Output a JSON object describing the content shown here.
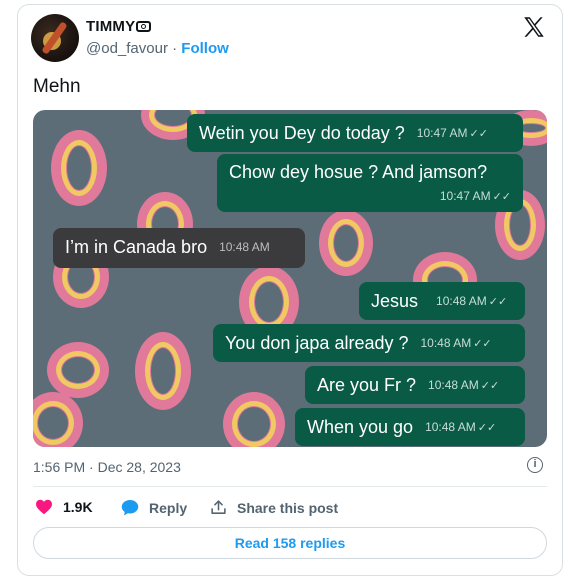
{
  "author": {
    "display_name": "TIMMY",
    "handle": "@od_favour",
    "separator": "·",
    "follow_label": "Follow"
  },
  "tweet": {
    "text": "Mehn",
    "timestamp": "1:56 PM · Dec 28, 2023"
  },
  "chat": {
    "messages": [
      {
        "text": "Wetin you Dey do today ?",
        "time": "10:47 AM",
        "direction": "outgoing"
      },
      {
        "text": "Chow dey hosue ? And jamson?",
        "time": "10:47 AM",
        "direction": "outgoing"
      },
      {
        "text": "I’m in Canada bro",
        "time": "10:48 AM",
        "direction": "incoming"
      },
      {
        "text": "Jesus",
        "time": "10:48 AM",
        "direction": "outgoing"
      },
      {
        "text": "You don japa already ?",
        "time": "10:48 AM",
        "direction": "outgoing"
      },
      {
        "text": "Are you Fr ?",
        "time": "10:48 AM",
        "direction": "outgoing"
      },
      {
        "text": "When you go",
        "time": "10:48 AM",
        "direction": "outgoing"
      }
    ],
    "read_ticks": "✓✓"
  },
  "actions": {
    "likes": "1.9K",
    "reply_label": "Reply",
    "share_label": "Share this post",
    "read_replies_label": "Read 158 replies"
  },
  "icons": {
    "logo": "x-logo-icon",
    "camera": "camera-icon",
    "like": "heart-icon",
    "reply": "reply-bubble-icon",
    "share": "share-icon",
    "info": "info-icon"
  },
  "colors": {
    "accent": "#1d9bf0",
    "like": "#f91880",
    "chat_outgoing": "#0a5b45",
    "chat_incoming": "#3b3b3d",
    "chat_wallpaper": "#5d6d78"
  }
}
